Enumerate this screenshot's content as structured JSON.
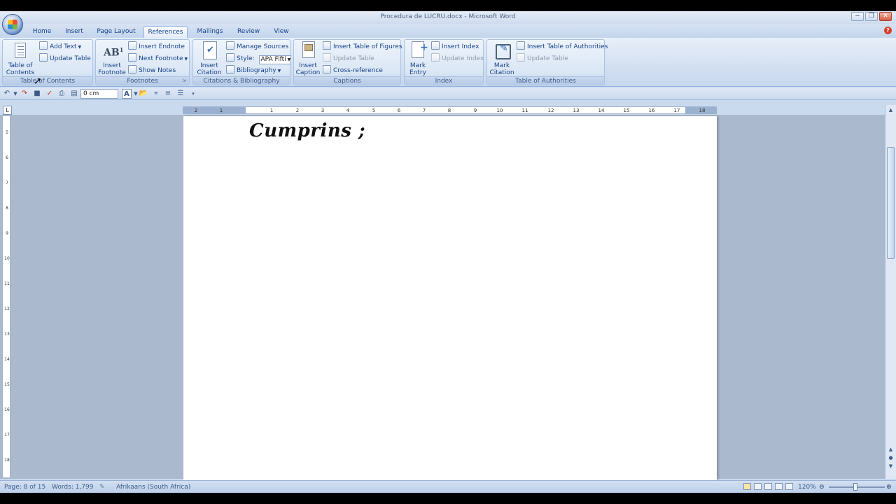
{
  "window": {
    "title": "Procedura de LUCRU.docx - Microsoft Word",
    "minimize_label": "−",
    "restore_label": "❐",
    "close_label": "✕"
  },
  "tabs": [
    "Home",
    "Insert",
    "Page Layout",
    "References",
    "Mailings",
    "Review",
    "View"
  ],
  "active_tab": "References",
  "ribbon": {
    "toc": {
      "label": "Table of Contents",
      "big_button": "Table of\nContents",
      "add_text": "Add Text",
      "update_table": "Update Table"
    },
    "footnotes": {
      "label": "Footnotes",
      "insert_footnote": "Insert\nFootnote",
      "insert_endnote": "Insert Endnote",
      "next_footnote": "Next Footnote",
      "show_notes": "Show Notes"
    },
    "citations": {
      "label": "Citations & Bibliography",
      "insert_citation": "Insert\nCitation",
      "manage_sources": "Manage Sources",
      "style_label": "Style:",
      "style_value": "APA Fifti",
      "bibliography": "Bibliography"
    },
    "captions": {
      "label": "Captions",
      "insert_caption": "Insert\nCaption",
      "insert_table_of_figures": "Insert Table of Figures",
      "update_table": "Update Table",
      "cross_reference": "Cross-reference"
    },
    "index": {
      "label": "Index",
      "mark_entry": "Mark\nEntry",
      "insert_index": "Insert Index",
      "update_index": "Update Index"
    },
    "authorities": {
      "label": "Table of Authorities",
      "mark_citation": "Mark\nCitation",
      "insert_table_of_authorities": "Insert Table of Authorities",
      "update_table": "Update Table"
    }
  },
  "qat": {
    "indent_value": "0 cm"
  },
  "ruler": {
    "ticks": [
      "2",
      "1",
      "1",
      "2",
      "3",
      "4",
      "5",
      "6",
      "7",
      "8",
      "9",
      "10",
      "11",
      "12",
      "13",
      "14",
      "15",
      "16",
      "17",
      "18"
    ],
    "vticks": [
      "5",
      "6",
      "7",
      "8",
      "9",
      "10",
      "11",
      "12",
      "13",
      "14",
      "15",
      "16",
      "17",
      "18"
    ]
  },
  "document": {
    "heading": "Cumprins ;"
  },
  "status": {
    "page": "Page: 8 of 15",
    "words": "Words: 1,799",
    "language": "Afrikaans (South Africa)",
    "zoom": "120%"
  }
}
